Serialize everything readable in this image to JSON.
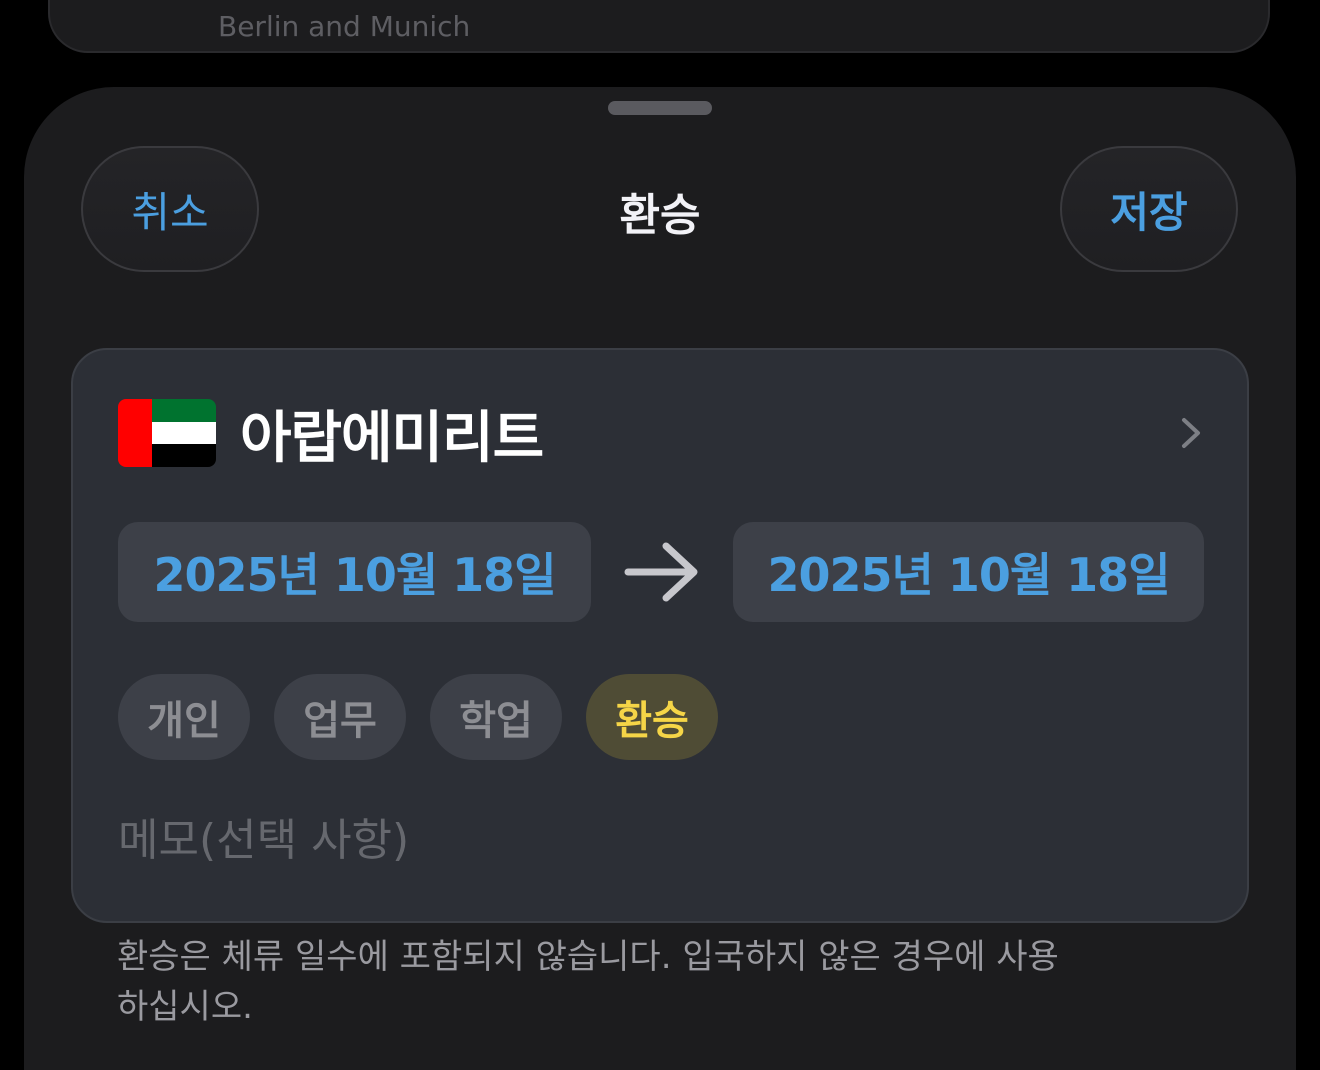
{
  "background_card": {
    "text": "Berlin and Munich"
  },
  "sheet": {
    "title": "환승",
    "cancel_label": "취소",
    "save_label": "저장"
  },
  "country": {
    "name": "아랍에미리트",
    "flag_colors": {
      "hoist": "#FF0000",
      "top": "#00732F",
      "middle": "#FFFFFF",
      "bottom": "#000000"
    }
  },
  "dates": {
    "start": "2025년 10월 18일",
    "end": "2025년 10월 18일"
  },
  "categories": [
    {
      "label": "개인",
      "selected": false
    },
    {
      "label": "업무",
      "selected": false
    },
    {
      "label": "학업",
      "selected": false
    },
    {
      "label": "환승",
      "selected": true
    }
  ],
  "memo": {
    "placeholder": "메모(선택 사항)",
    "value": ""
  },
  "footnote": "환승은 체류 일수에 포함되지 않습니다. 입국하지 않은 경우에 사용하십시오.",
  "colors": {
    "accent_blue": "#4B9FE0",
    "selected_chip_text": "#F5D547"
  }
}
